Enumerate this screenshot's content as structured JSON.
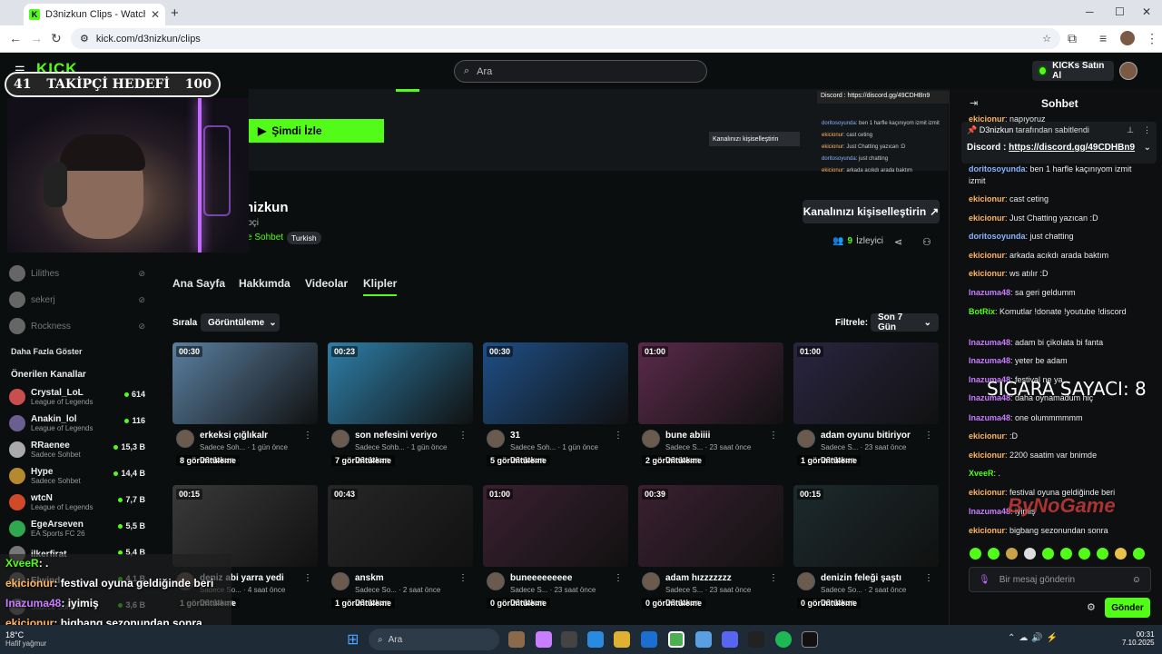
{
  "browser": {
    "tab_title": "D3nizkun Clips - Watch Live on",
    "url": "kick.com/d3nizkun/clips"
  },
  "header": {
    "logo": "KICK",
    "search_placeholder": "Ara",
    "buy_label": "KICKs Satın Al"
  },
  "overlay": {
    "goal_current": "41",
    "goal_label": "TAKİPÇİ HEDEFİ",
    "goal_target": "100",
    "chat": [
      {
        "user": "XveeR",
        "text": ": ."
      },
      {
        "user": "ekicionur",
        "text": ": festival oyuna geldiğinde beri"
      },
      {
        "user": "Inazuma48",
        "text": ": iyimiş"
      },
      {
        "user": "ekicionur",
        "text": ": bigbang sezonundan sonra"
      }
    ],
    "sigara": "SIGARA SAYACI: 8",
    "bynogame": "ByNoGame"
  },
  "channel": {
    "watch_label": "Şimdi İzle",
    "name": "nizkun",
    "sub": "ipçi",
    "category": "e Sohbet",
    "language_tag": "Turkish",
    "customize_label": "Kanalınızı kişiselleştirin",
    "viewers_count": "9",
    "viewers_label": "İzleyici",
    "mini_discord": "Discord : https://discord.gg/49CDHBn9",
    "mini_customize": "Kanalınızı kişiselleştirin"
  },
  "profile_tabs": [
    "Ana Sayfa",
    "Hakkımda",
    "Videolar",
    "Klipler"
  ],
  "sort": {
    "label": "Sırala",
    "value": "Görüntüleme"
  },
  "filter": {
    "label": "Filtrele:",
    "value": "Son 7 Gün"
  },
  "clips": [
    {
      "dur": "00:30",
      "views": "8 görüntüleme",
      "title": "erkeksi çığlıkalr",
      "meta": "Sadece Soh... · 1 gün önce",
      "author": "D3nizkun",
      "color": "#5a7fa0"
    },
    {
      "dur": "00:23",
      "views": "7 görüntüleme",
      "title": "son nefesini veriyo",
      "meta": "Sadece Sohb... · 1 gün önce",
      "author": "D3nizkun",
      "color": "#2d7fa8"
    },
    {
      "dur": "00:30",
      "views": "5 görüntüleme",
      "title": "31",
      "meta": "Sadece Soh... · 1 gün önce",
      "author": "D3nizkun",
      "color": "#1e4f86"
    },
    {
      "dur": "01:00",
      "views": "2 görüntüleme",
      "title": "bune abiiii",
      "meta": "Sadece S... · 23 saat önce",
      "author": "D3nizkun",
      "color": "#5a2a4a"
    },
    {
      "dur": "01:00",
      "views": "1 görüntüleme",
      "title": "adam oyunu bitiriyor",
      "meta": "Sadece S... · 23 saat önce",
      "author": "D3nizkun",
      "color": "#2a2540"
    },
    {
      "dur": "00:15",
      "views": "1 görüntüleme",
      "title": "deniz abi yarra yedi",
      "meta": "Sadece So... · 4 saat önce",
      "author": "D3nizkun",
      "color": "#3a3a3a"
    },
    {
      "dur": "00:43",
      "views": "1 görüntüleme",
      "title": "anskm",
      "meta": "Sadece So... · 2 saat önce",
      "author": "D3nizkun",
      "color": "#262626"
    },
    {
      "dur": "01:00",
      "views": "0 görüntüleme",
      "title": "buneeeeeeeee",
      "meta": "Sadece S... · 23 saat önce",
      "author": "D3nizkun",
      "color": "#3a2030"
    },
    {
      "dur": "00:39",
      "views": "0 görüntüleme",
      "title": "adam hızzzzzzz",
      "meta": "Sadece S... · 23 saat önce",
      "author": "D3nizkun",
      "color": "#3a2030"
    },
    {
      "dur": "00:15",
      "views": "0 görüntüleme",
      "title": "denizin feleği şaştı",
      "meta": "Sadece So... · 2 saat önce",
      "author": "D3nizkun",
      "color": "#1c2a2c"
    }
  ],
  "sidebar": {
    "offline": [
      "Lilithes",
      "sekerj",
      "Rockness"
    ],
    "more_label": "Daha Fazla Göster",
    "rec_title": "Önerilen Kanallar",
    "recommended": [
      {
        "name": "Crystal_LoL",
        "game": "League of Legends",
        "count": "614",
        "color": "#c94f4f"
      },
      {
        "name": "Anakin_lol",
        "game": "League of Legends",
        "count": "116",
        "color": "#6a5f8f"
      },
      {
        "name": "RRaenee",
        "game": "Sadece Sohbet",
        "count": "15,3 B",
        "color": "#aaaaaa"
      },
      {
        "name": "Hype",
        "game": "Sadece Sohbet",
        "count": "14,4 B",
        "color": "#b58a2f"
      },
      {
        "name": "wtcN",
        "game": "League of Legends",
        "count": "7,7 B",
        "color": "#d04a2a"
      },
      {
        "name": "EgeArseven",
        "game": "EA Sports FC 26",
        "count": "5,5 B",
        "color": "#2fa84f"
      },
      {
        "name": "ilkerfirat",
        "game": "",
        "count": "5,4 B",
        "color": "#777777"
      },
      {
        "name": "Elwind",
        "game": "",
        "count": "4,1 B",
        "color": "#777777"
      },
      {
        "name": "",
        "game": "Sadece Sohbet",
        "count": "3,6 B",
        "color": "#777777"
      }
    ]
  },
  "chat": {
    "title": "Sohbet",
    "pinned_by": "D3nizkun",
    "pinned_by_suffix": "tarafından sabitlendi",
    "pinned_text": "Discord : ",
    "pinned_link": "https://discord.gg/49CDHBn9",
    "messages": [
      {
        "user": "ekicionur",
        "cls": "u-ek",
        "text": ": napıyoruz"
      },
      {
        "user": "doritosoyunda",
        "cls": "u-do",
        "text": ": ben 1 harfle kaçınıyom izmit izmit"
      },
      {
        "user": "ekicionur",
        "cls": "u-ek",
        "text": ": cast ceting"
      },
      {
        "user": "ekicionur",
        "cls": "u-ek",
        "text": ": Just Chatting yazıcan :D"
      },
      {
        "user": "doritosoyunda",
        "cls": "u-do",
        "text": ": just chatting"
      },
      {
        "user": "ekicionur",
        "cls": "u-ek",
        "text": ": arkada acıkdı arada baktım"
      },
      {
        "user": "ekicionur",
        "cls": "u-ek",
        "text": ": ws atılır :D"
      },
      {
        "user": "Inazuma48",
        "cls": "u-in",
        "text": ": sa geri geldumm"
      },
      {
        "user": "BotRix",
        "cls": "u-bot",
        "text": ": Komutlar !donate !youtube !discord"
      },
      {
        "user": "Inazuma48",
        "cls": "u-in",
        "text": ": adam bi çikolata bi fanta"
      },
      {
        "user": "Inazuma48",
        "cls": "u-in",
        "text": ": yeter be adam"
      },
      {
        "user": "Inazuma48",
        "cls": "u-in",
        "text": ": festival ne ya"
      },
      {
        "user": "Inazuma48",
        "cls": "u-in",
        "text": ": daha oynamadum hiç"
      },
      {
        "user": "Inazuma48",
        "cls": "u-in",
        "text": ": one olummmmmm"
      },
      {
        "user": "ekicionur",
        "cls": "u-ek",
        "text": ": :D"
      },
      {
        "user": "ekicionur",
        "cls": "u-ek",
        "text": ": 2200 saatim var bnimde"
      },
      {
        "user": "XveeR",
        "cls": "u-xv",
        "text": ": ."
      },
      {
        "user": "ekicionur",
        "cls": "u-ek",
        "text": ": festival oyuna geldiğinde beri"
      },
      {
        "user": "Inazuma48",
        "cls": "u-in",
        "text": ": iyimiş"
      },
      {
        "user": "ekicionur",
        "cls": "u-ek",
        "text": ": bigbang sezonundan sonra"
      }
    ],
    "input_placeholder": "Bir mesaj gönderin",
    "send_label": "Gönder"
  },
  "taskbar": {
    "temp": "18°C",
    "weather": "Hafif yağmur",
    "search": "Ara",
    "time": "00:31",
    "date": "7.10.2025"
  }
}
